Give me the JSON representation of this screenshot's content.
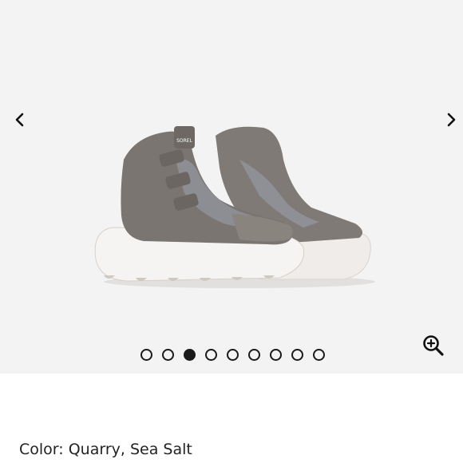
{
  "gallery": {
    "prev_icon": "chevron-left-icon",
    "next_icon": "chevron-right-icon",
    "zoom_icon": "zoom-in-icon",
    "image_alt": "Grey suede high-top sneakers with white chunky sole",
    "brand_logo_text": "SOREL",
    "dots_count": 9,
    "active_index": 2
  },
  "product": {
    "color_label": "Color: Quarry, Sea Salt"
  },
  "colors": {
    "background": "#f3f3f3",
    "shoe_upper": "#7d7873",
    "felt": "#8e8f93",
    "sole": "#f2efec",
    "accent": "#1a1a1a"
  }
}
